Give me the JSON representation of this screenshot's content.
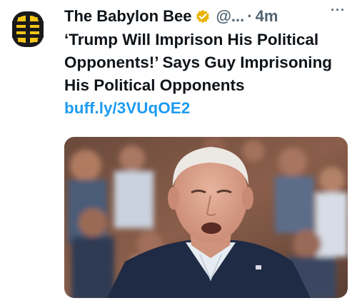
{
  "tweet": {
    "author": "The Babylon Bee",
    "handle": "@...",
    "separator": "·",
    "time": "4m",
    "more_label": "···",
    "text": "‘Trump Will Imprison His Political Opponents!’ Says Guy Imprisoning His Political Opponents",
    "link": "buff.ly/3VUqOE2"
  },
  "icons": {
    "avatar": "babylon-bee-logo-icon",
    "verified": "gold-verified-badge-icon",
    "more": "more-options-icon"
  },
  "colors": {
    "text": "#0f1419",
    "secondary": "#536471",
    "link": "#1d9bf0",
    "badge": "#e8b400",
    "logo_dark": "#1a1a1a",
    "logo_yellow": "#f5c518"
  }
}
